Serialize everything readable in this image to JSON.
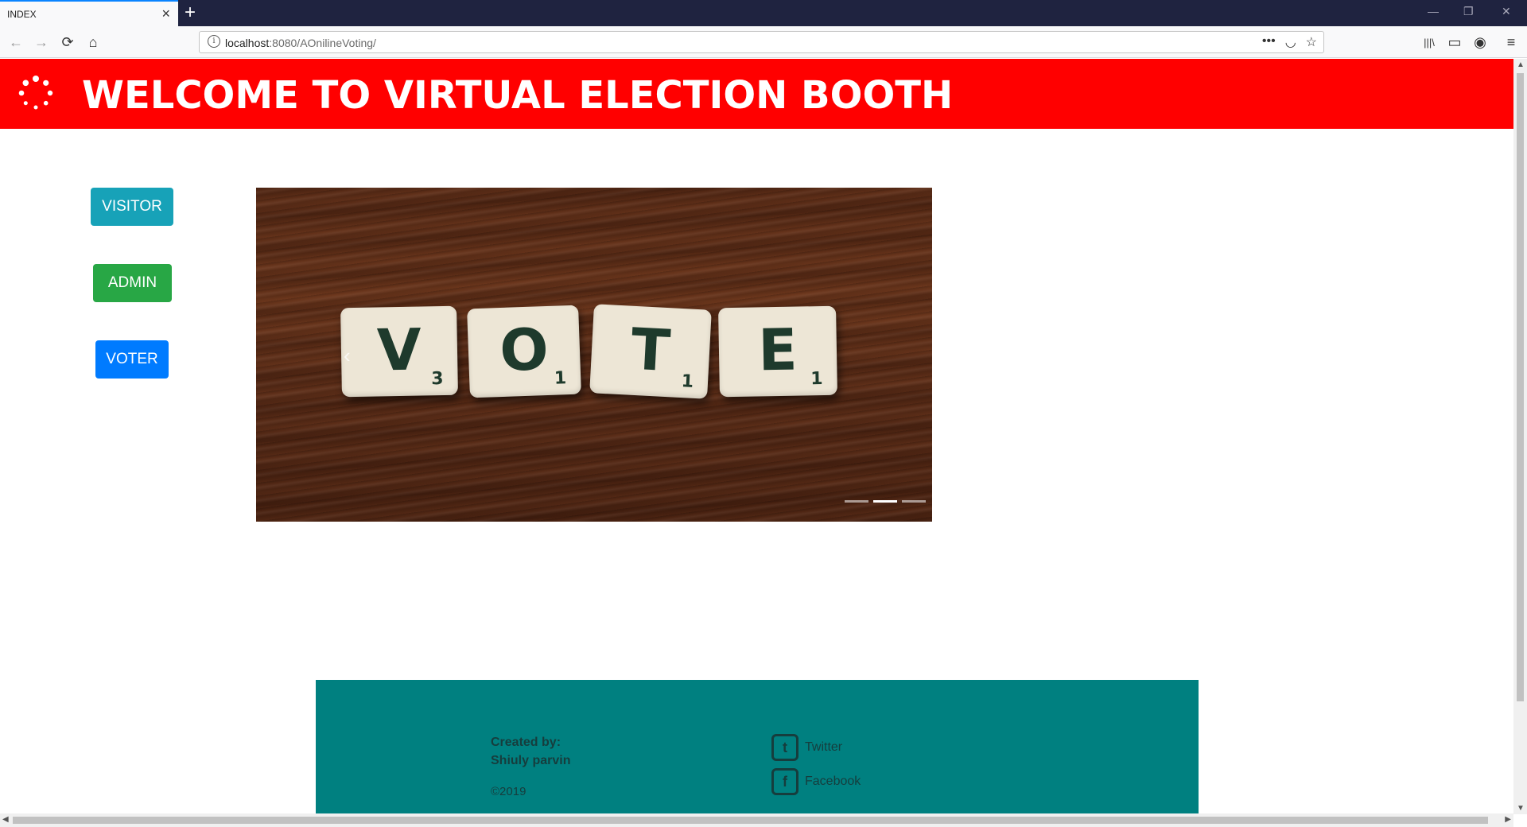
{
  "browser": {
    "tab_title": "INDEX",
    "tab_close": "×",
    "new_tab": "+",
    "url_host": "localhost",
    "url_rest": ":8080/AOnilineVoting/",
    "back_icon": "←",
    "forward_icon": "→",
    "reload_icon": "⟳",
    "home_icon": "⌂",
    "page_actions_icon": "•••",
    "pocket_icon": "◡",
    "bookmark_icon": "☆",
    "library_icon": "|||\\",
    "sidebar_icon": "▭",
    "account_icon": "◉",
    "menu_icon": "≡",
    "minimize_icon": "—",
    "restore_icon": "❐",
    "close_icon": "✕"
  },
  "header": {
    "title": "WELCOME TO VIRTUAL ELECTION BOOTH"
  },
  "sidebar": {
    "buttons": [
      {
        "label": "VISITOR"
      },
      {
        "label": "ADMIN"
      },
      {
        "label": "VOTER"
      }
    ]
  },
  "carousel": {
    "prev_icon": "‹",
    "tiles": [
      {
        "letter": "V",
        "score": "3"
      },
      {
        "letter": "O",
        "score": "1"
      },
      {
        "letter": "T",
        "score": "1"
      },
      {
        "letter": "E",
        "score": "1"
      }
    ],
    "slide_count": 3,
    "active_slide": 2
  },
  "footer": {
    "credit_label": "Created by:",
    "credit_name": "Shiuly parvin",
    "year": "©2019",
    "links": [
      {
        "label": "Twitter",
        "icon": "twitter-icon",
        "glyph": "t"
      },
      {
        "label": "Facebook",
        "icon": "facebook-icon",
        "glyph": "f"
      }
    ]
  },
  "colors": {
    "header_bg": "#ff0000",
    "visitor_btn": "#17a2b8",
    "admin_btn": "#28a745",
    "voter_btn": "#007bff",
    "footer_bg": "#008080"
  }
}
